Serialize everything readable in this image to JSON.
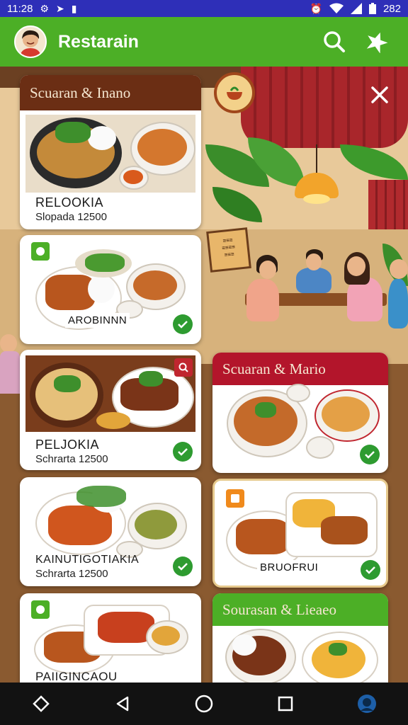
{
  "status_bar": {
    "time": "11:28",
    "right_text": "282"
  },
  "app_bar": {
    "title": "Restarain"
  },
  "cards": [
    {
      "header": "Scuaran & Inano",
      "title": "RELOOKIA",
      "subtitle": "Slopada 12500"
    },
    {
      "plate_label": "AROBINNN"
    },
    {
      "title": "PELJOKIA",
      "subtitle": "Schrarta 12500"
    },
    {
      "header": "Scuaran & Mario"
    },
    {
      "title": "KAINUTIGOTIAKIA",
      "subtitle": "Schrarta 12500"
    },
    {
      "plate_label": "BRUOFRUI"
    },
    {
      "plate_label": "PAIIGINCAOU"
    },
    {
      "header": "Sourasan & Lieaeo"
    }
  ],
  "colors": {
    "app_bar": "#4caf26",
    "status_bar": "#2e2fb8",
    "header_brown": "#6b2e14",
    "header_red": "#b3152b",
    "header_green": "#4caf26",
    "check_green": "#2e9b30"
  }
}
